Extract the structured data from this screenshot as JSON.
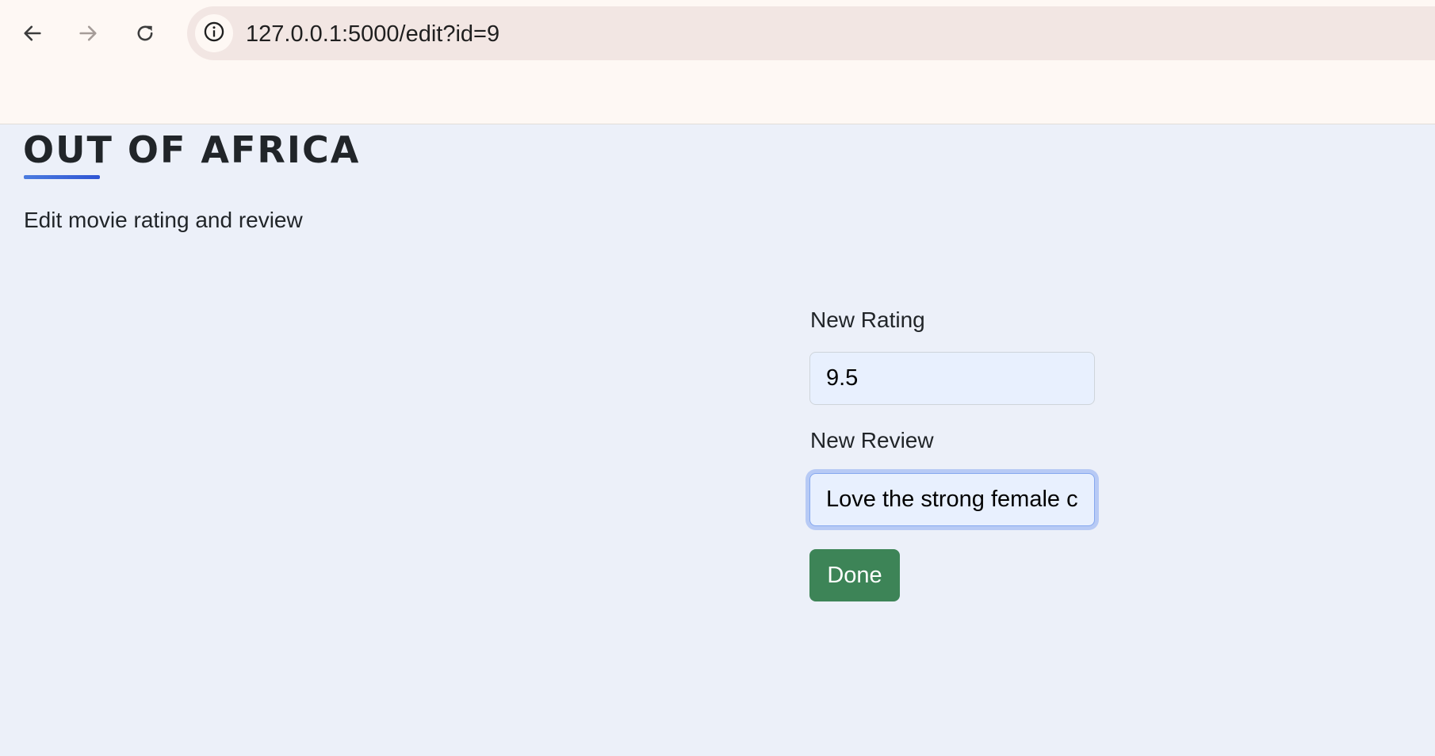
{
  "browser": {
    "url": "127.0.0.1:5000/edit?id=9",
    "icons": {
      "back": "arrow-left-icon",
      "forward": "arrow-right-icon",
      "reload": "reload-icon",
      "site_info": "info-circle-icon"
    }
  },
  "page": {
    "title": "OUT OF AFRICA",
    "subtitle": "Edit movie rating and review",
    "accent_color": "#3a62d8"
  },
  "form": {
    "rating_label": "New Rating",
    "rating_value": "9.5",
    "review_label": "New Review",
    "review_value": "Love the strong female c",
    "submit_label": "Done",
    "submit_color": "#3d8457"
  }
}
